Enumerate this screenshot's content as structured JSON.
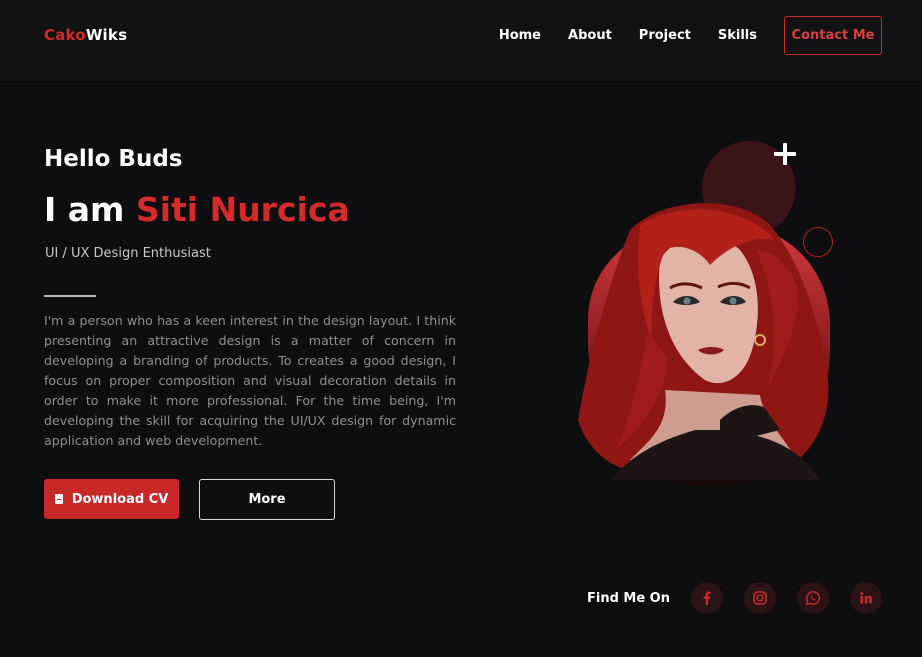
{
  "nav": {
    "logo_accent": "Cako",
    "logo_rest": "Wiks",
    "links": [
      "Home",
      "About",
      "Project",
      "Skills"
    ],
    "contact_label": "Contact Me"
  },
  "hero": {
    "greeting": "Hello Buds",
    "headline_prefix": "I am ",
    "name": "Siti Nurcica",
    "role": "UI / UX Design Enthusiast",
    "bio": "I'm a person who has a keen interest in the design layout. I think presenting an attractive design is a matter of concern in developing a branding of products. To creates a good design, I focus on proper composition and visual decoration details in order to make it more professional. For the time being, I'm developing the skill for acquiring the UI/UX design for dynamic application and web development.",
    "download_label": "Download CV",
    "more_label": "More"
  },
  "social": {
    "label": "Find Me On",
    "icons": [
      "facebook-icon",
      "instagram-icon",
      "whatsapp-icon",
      "linkedin-icon"
    ]
  },
  "colors": {
    "accent": "#d42a2a",
    "background": "#0e0e10",
    "nav_background": "#121214",
    "social_circle": "#2b1214"
  }
}
